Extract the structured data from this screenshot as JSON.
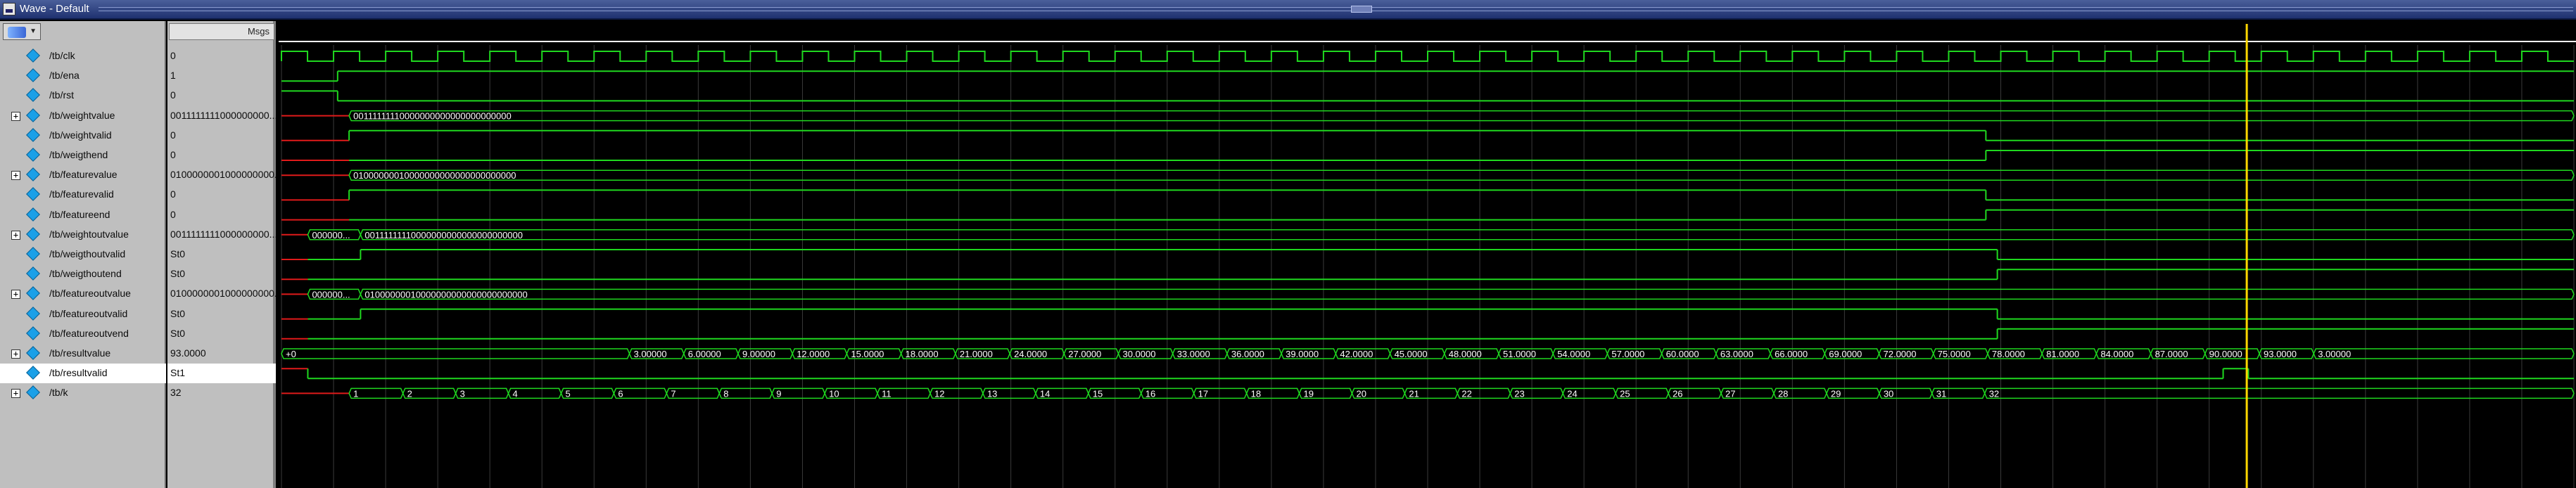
{
  "window": {
    "title": "Wave - Default",
    "value_column_header": "Msgs"
  },
  "colors": {
    "wave_green": "#1fd81f",
    "undefined_red": "#e01a1a",
    "cursor_yellow": "#ffd700",
    "grid": "#3a3a3a",
    "signal_icon": "#1aa0e8"
  },
  "icons": {
    "signal": "diamond-signal-icon",
    "expand": "plus-box-icon",
    "tool": "wave-tool-icon"
  },
  "cursor": {
    "time_fraction": 0.8573
  },
  "clock": {
    "cycles": 44,
    "x0": 0.0,
    "x1": 1.0
  },
  "signals": [
    {
      "name": "/tb/clk",
      "value": "0",
      "bus": false,
      "kind": "clock"
    },
    {
      "name": "/tb/ena",
      "value": "1",
      "bus": false,
      "kind": "bit",
      "trace": [
        [
          0.0,
          0,
          "g"
        ],
        [
          0.0245,
          1,
          "g"
        ],
        [
          1.0,
          1,
          "g"
        ]
      ]
    },
    {
      "name": "/tb/rst",
      "value": "0",
      "bus": false,
      "kind": "bit",
      "trace": [
        [
          0.0,
          1,
          "g"
        ],
        [
          0.0245,
          0,
          "g"
        ],
        [
          1.0,
          0,
          "g"
        ]
      ]
    },
    {
      "name": "/tb/weightvalue",
      "value": "0011111111000000000...",
      "bus": true,
      "kind": "bus",
      "segments": [
        [
          0.0,
          0.0295,
          "",
          "red"
        ],
        [
          0.0295,
          1.0,
          "00111111110000000000000000000000",
          "g"
        ]
      ]
    },
    {
      "name": "/tb/weightvalid",
      "value": "0",
      "bus": false,
      "kind": "bit",
      "trace": [
        [
          0.0,
          0,
          "r"
        ],
        [
          0.0295,
          1,
          "g"
        ],
        [
          0.7435,
          0,
          "g"
        ],
        [
          1.0,
          0,
          "g"
        ]
      ]
    },
    {
      "name": "/tb/weigthend",
      "value": "0",
      "bus": false,
      "kind": "bit",
      "trace": [
        [
          0.0,
          0,
          "r"
        ],
        [
          0.0295,
          0,
          "g"
        ],
        [
          0.7435,
          1,
          "g"
        ],
        [
          1.0,
          1,
          "g"
        ]
      ]
    },
    {
      "name": "/tb/featurevalue",
      "value": "0100000001000000000...",
      "bus": true,
      "kind": "bus",
      "segments": [
        [
          0.0,
          0.0295,
          "",
          "red"
        ],
        [
          0.0295,
          1.0,
          "01000000010000000000000000000000",
          "g"
        ]
      ]
    },
    {
      "name": "/tb/featurevalid",
      "value": "0",
      "bus": false,
      "kind": "bit",
      "trace": [
        [
          0.0,
          0,
          "r"
        ],
        [
          0.0295,
          1,
          "g"
        ],
        [
          0.7435,
          0,
          "g"
        ],
        [
          1.0,
          0,
          "g"
        ]
      ]
    },
    {
      "name": "/tb/featureend",
      "value": "0",
      "bus": false,
      "kind": "bit",
      "trace": [
        [
          0.0,
          0,
          "r"
        ],
        [
          0.0295,
          0,
          "g"
        ],
        [
          0.7435,
          1,
          "g"
        ],
        [
          1.0,
          1,
          "g"
        ]
      ]
    },
    {
      "name": "/tb/weightoutvalue",
      "value": "0011111111000000000...",
      "bus": true,
      "kind": "bus",
      "segments": [
        [
          0.0,
          0.0115,
          "",
          "red"
        ],
        [
          0.0115,
          0.0345,
          "000000...",
          "g"
        ],
        [
          0.0345,
          1.0,
          "00111111110000000000000000000000",
          "g"
        ]
      ]
    },
    {
      "name": "/tb/weigthoutvalid",
      "value": "St0",
      "bus": false,
      "kind": "bit",
      "trace": [
        [
          0.0,
          0,
          "r"
        ],
        [
          0.0115,
          0,
          "g"
        ],
        [
          0.0345,
          1,
          "g"
        ],
        [
          0.7485,
          0,
          "g"
        ],
        [
          1.0,
          0,
          "g"
        ]
      ]
    },
    {
      "name": "/tb/weigthoutend",
      "value": "St0",
      "bus": false,
      "kind": "bit",
      "trace": [
        [
          0.0,
          0,
          "r"
        ],
        [
          0.0115,
          0,
          "g"
        ],
        [
          0.7485,
          1,
          "g"
        ],
        [
          1.0,
          1,
          "g"
        ]
      ]
    },
    {
      "name": "/tb/featureoutvalue",
      "value": "0100000001000000000...",
      "bus": true,
      "kind": "bus",
      "segments": [
        [
          0.0,
          0.0115,
          "",
          "red"
        ],
        [
          0.0115,
          0.0345,
          "000000...",
          "g"
        ],
        [
          0.0345,
          1.0,
          "01000000010000000000000000000000",
          "g"
        ]
      ]
    },
    {
      "name": "/tb/featureoutvalid",
      "value": "St0",
      "bus": false,
      "kind": "bit",
      "trace": [
        [
          0.0,
          0,
          "r"
        ],
        [
          0.0115,
          0,
          "g"
        ],
        [
          0.0345,
          1,
          "g"
        ],
        [
          0.7485,
          0,
          "g"
        ],
        [
          1.0,
          0,
          "g"
        ]
      ]
    },
    {
      "name": "/tb/featureoutvend",
      "value": "St0",
      "bus": false,
      "kind": "bit",
      "trace": [
        [
          0.0,
          0,
          "r"
        ],
        [
          0.0115,
          0,
          "g"
        ],
        [
          0.7485,
          1,
          "g"
        ],
        [
          1.0,
          1,
          "g"
        ]
      ]
    },
    {
      "name": "/tb/resultvalue",
      "value": "93.0000",
      "bus": true,
      "kind": "bus",
      "segments": [
        [
          0.0,
          0.1518,
          "+0",
          "g"
        ],
        [
          0.1518,
          0.1755,
          "3.00000",
          "g"
        ],
        [
          0.1755,
          0.1992,
          "6.00000",
          "g"
        ],
        [
          0.1992,
          0.2229,
          "9.00000",
          "g"
        ],
        [
          0.2229,
          0.2466,
          "12.0000",
          "g"
        ],
        [
          0.2466,
          0.2703,
          "15.0000",
          "g"
        ],
        [
          0.2703,
          0.294,
          "18.0000",
          "g"
        ],
        [
          0.294,
          0.3177,
          "21.0000",
          "g"
        ],
        [
          0.3177,
          0.3414,
          "24.0000",
          "g"
        ],
        [
          0.3414,
          0.3651,
          "27.0000",
          "g"
        ],
        [
          0.3651,
          0.3888,
          "30.0000",
          "g"
        ],
        [
          0.3888,
          0.4125,
          "33.0000",
          "g"
        ],
        [
          0.4125,
          0.4362,
          "36.0000",
          "g"
        ],
        [
          0.4362,
          0.4599,
          "39.0000",
          "g"
        ],
        [
          0.4599,
          0.4836,
          "42.0000",
          "g"
        ],
        [
          0.4836,
          0.5073,
          "45.0000",
          "g"
        ],
        [
          0.5073,
          0.531,
          "48.0000",
          "g"
        ],
        [
          0.531,
          0.5547,
          "51.0000",
          "g"
        ],
        [
          0.5547,
          0.5784,
          "54.0000",
          "g"
        ],
        [
          0.5784,
          0.6021,
          "57.0000",
          "g"
        ],
        [
          0.6021,
          0.6258,
          "60.0000",
          "g"
        ],
        [
          0.6258,
          0.6495,
          "63.0000",
          "g"
        ],
        [
          0.6495,
          0.6732,
          "66.0000",
          "g"
        ],
        [
          0.6732,
          0.6969,
          "69.0000",
          "g"
        ],
        [
          0.6969,
          0.7206,
          "72.0000",
          "g"
        ],
        [
          0.7206,
          0.7443,
          "75.0000",
          "g"
        ],
        [
          0.7443,
          0.768,
          "78.0000",
          "g"
        ],
        [
          0.768,
          0.7917,
          "81.0000",
          "g"
        ],
        [
          0.7917,
          0.8154,
          "84.0000",
          "g"
        ],
        [
          0.8154,
          0.8391,
          "87.0000",
          "g"
        ],
        [
          0.8391,
          0.8628,
          "90.0000",
          "g"
        ],
        [
          0.8628,
          0.8865,
          "93.0000",
          "g"
        ],
        [
          0.8865,
          1.0,
          "3.00000",
          "g"
        ]
      ]
    },
    {
      "name": "/tb/resultvalid",
      "value": "St1",
      "bus": false,
      "kind": "bit",
      "selected": true,
      "trace": [
        [
          0.0,
          1,
          "r"
        ],
        [
          0.0115,
          0,
          "g"
        ],
        [
          0.847,
          1,
          "g"
        ],
        [
          0.858,
          0,
          "g"
        ],
        [
          1.0,
          0,
          "g"
        ]
      ]
    },
    {
      "name": "/tb/k",
      "value": "32",
      "bus": true,
      "kind": "bus",
      "segments": [
        [
          0.0,
          0.0295,
          "",
          "red"
        ],
        [
          0.0295,
          0.053,
          "1",
          "g"
        ],
        [
          0.053,
          0.076,
          "2",
          "g"
        ],
        [
          0.076,
          0.099,
          "3",
          "g"
        ],
        [
          0.099,
          0.122,
          "4",
          "g"
        ],
        [
          0.122,
          0.145,
          "5",
          "g"
        ],
        [
          0.145,
          0.168,
          "6",
          "g"
        ],
        [
          0.168,
          0.191,
          "7",
          "g"
        ],
        [
          0.191,
          0.214,
          "8",
          "g"
        ],
        [
          0.214,
          0.237,
          "9",
          "g"
        ],
        [
          0.237,
          0.26,
          "10",
          "g"
        ],
        [
          0.26,
          0.283,
          "11",
          "g"
        ],
        [
          0.283,
          0.306,
          "12",
          "g"
        ],
        [
          0.306,
          0.329,
          "13",
          "g"
        ],
        [
          0.329,
          0.352,
          "14",
          "g"
        ],
        [
          0.352,
          0.375,
          "15",
          "g"
        ],
        [
          0.375,
          0.398,
          "16",
          "g"
        ],
        [
          0.398,
          0.421,
          "17",
          "g"
        ],
        [
          0.421,
          0.444,
          "18",
          "g"
        ],
        [
          0.444,
          0.467,
          "19",
          "g"
        ],
        [
          0.467,
          0.49,
          "20",
          "g"
        ],
        [
          0.49,
          0.513,
          "21",
          "g"
        ],
        [
          0.513,
          0.536,
          "22",
          "g"
        ],
        [
          0.536,
          0.559,
          "23",
          "g"
        ],
        [
          0.559,
          0.582,
          "24",
          "g"
        ],
        [
          0.582,
          0.605,
          "25",
          "g"
        ],
        [
          0.605,
          0.628,
          "26",
          "g"
        ],
        [
          0.628,
          0.651,
          "27",
          "g"
        ],
        [
          0.651,
          0.674,
          "28",
          "g"
        ],
        [
          0.674,
          0.697,
          "29",
          "g"
        ],
        [
          0.697,
          0.72,
          "30",
          "g"
        ],
        [
          0.72,
          0.743,
          "31",
          "g"
        ],
        [
          0.743,
          1.0,
          "32",
          "g"
        ]
      ]
    }
  ]
}
